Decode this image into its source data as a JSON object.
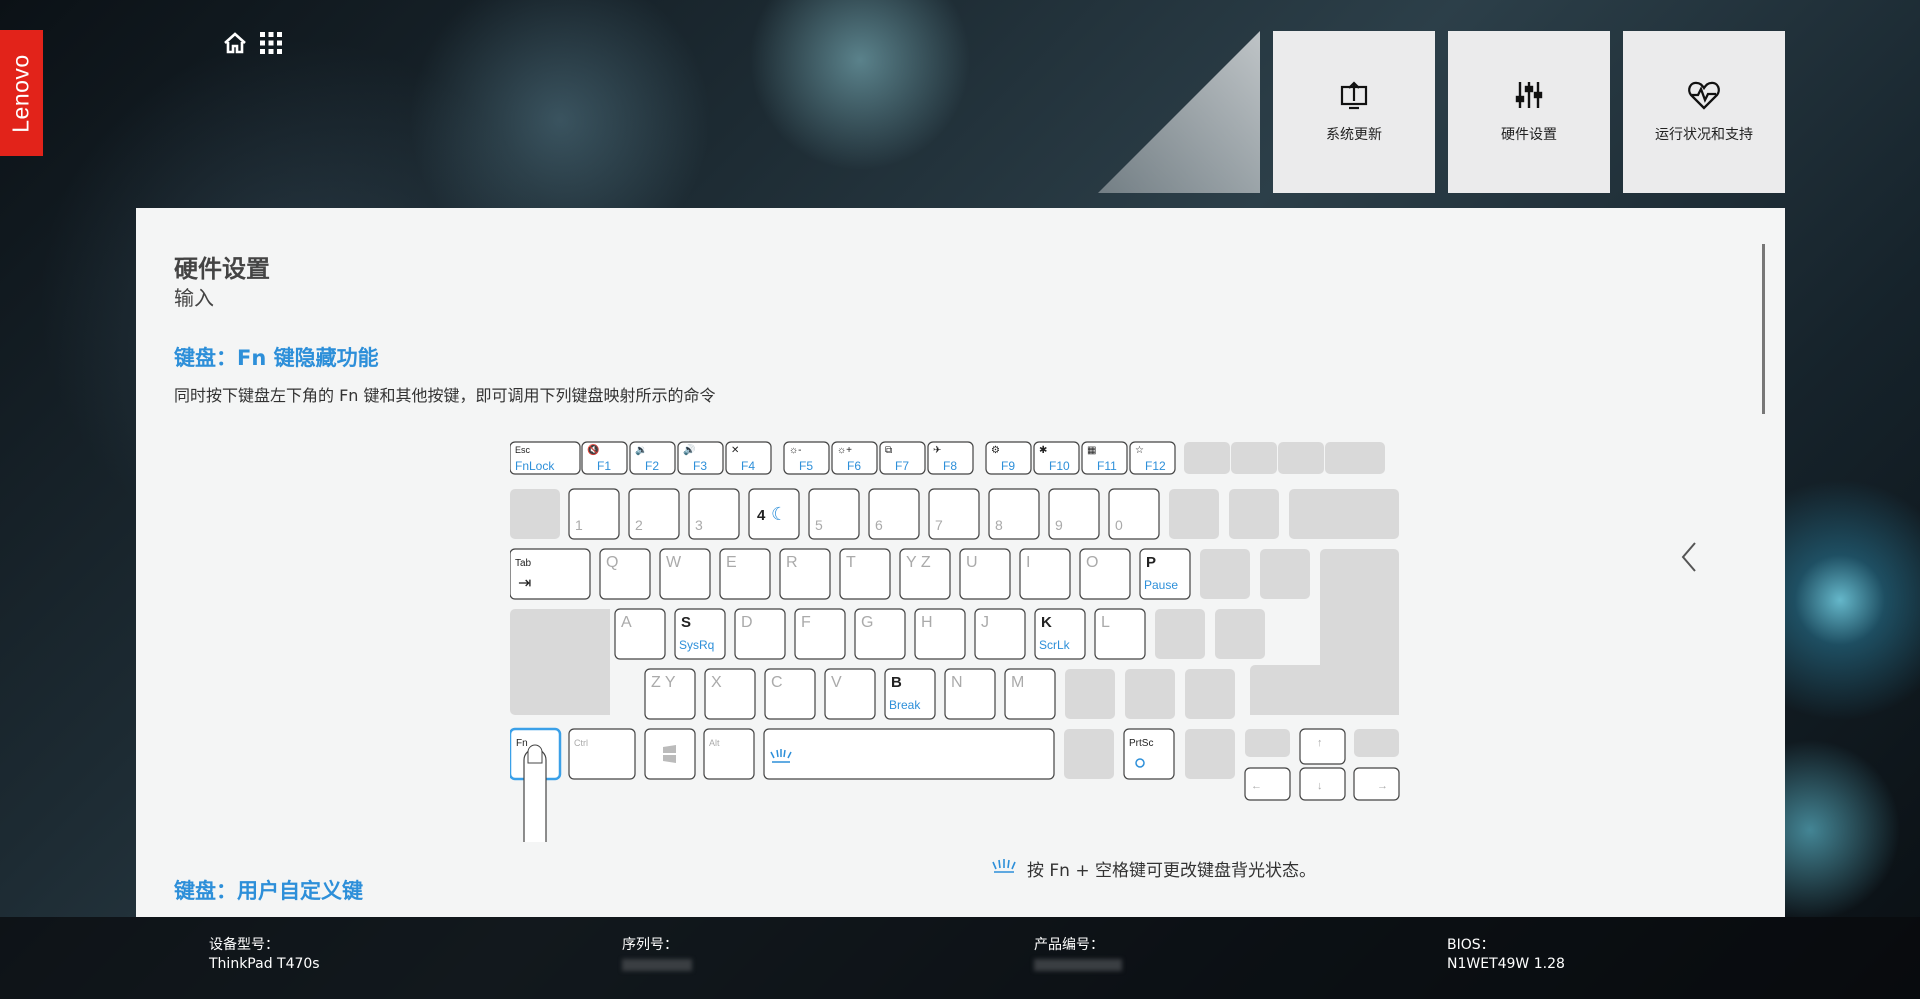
{
  "brand": "Lenovo",
  "nav": {
    "home_icon": "home-icon",
    "apps_icon": "grid-icon"
  },
  "tiles": [
    {
      "label": "系统更新",
      "icon": "system-update-icon"
    },
    {
      "label": "硬件设置",
      "icon": "sliders-icon"
    },
    {
      "label": "运行状况和支持",
      "icon": "heart-pulse-icon"
    }
  ],
  "page": {
    "title": "硬件设置",
    "subtitle": "输入",
    "section1_title": "键盘：Fn 键隐藏功能",
    "section1_desc": "同时按下键盘左下角的 Fn 键和其他按键，即可调用下列键盘映射所示的命令",
    "backlight_note": "按 Fn + 空格键可更改键盘背光状态。",
    "section2_title": "键盘：用户自定义键"
  },
  "keyboard": {
    "fnrow": [
      {
        "top": "Esc",
        "bot": "FnLock"
      },
      {
        "top": "🔇",
        "bot": "F1"
      },
      {
        "top": "🔉",
        "bot": "F2"
      },
      {
        "top": "🔊",
        "bot": "F3"
      },
      {
        "top": "✕",
        "bot": "F4"
      },
      {
        "top": "☼-",
        "bot": "F5"
      },
      {
        "top": "☼+",
        "bot": "F6"
      },
      {
        "top": "⧉",
        "bot": "F7"
      },
      {
        "top": "✈",
        "bot": "F8"
      },
      {
        "top": "⚙",
        "bot": "F9"
      },
      {
        "top": "✱",
        "bot": "F10"
      },
      {
        "top": "▦",
        "bot": "F11"
      },
      {
        "top": "☆",
        "bot": "F12"
      }
    ],
    "numrow": [
      "1",
      "2",
      "3",
      "4",
      "5",
      "6",
      "7",
      "8",
      "9",
      "0"
    ],
    "qrow": [
      "Q",
      "W",
      "E",
      "R",
      "T",
      "Y Z",
      "U",
      "I",
      "O",
      "P"
    ],
    "arow": [
      "A",
      "S",
      "D",
      "F",
      "G",
      "H",
      "J",
      "K",
      "L"
    ],
    "zrow": [
      "Z Y",
      "X",
      "C",
      "V",
      "B",
      "N",
      "M"
    ],
    "special": {
      "tab": "Tab",
      "pause": "Pause",
      "sysrq": "SysRq",
      "scrlk": "ScrLk",
      "brk": "Break",
      "fn": "Fn",
      "ctrl": "Ctrl",
      "alt": "Alt",
      "prtsc": "PrtSc"
    }
  },
  "footer": {
    "model_label": "设备型号：",
    "model_value": "ThinkPad T470s",
    "serial_label": "序列号：",
    "product_label": "产品编号：",
    "bios_label": "BIOS：",
    "bios_value": "N1WET49W 1.28"
  },
  "colors": {
    "accent": "#2d8fd9",
    "brand": "#e2231a",
    "key_gray": "#d9d9d9"
  }
}
